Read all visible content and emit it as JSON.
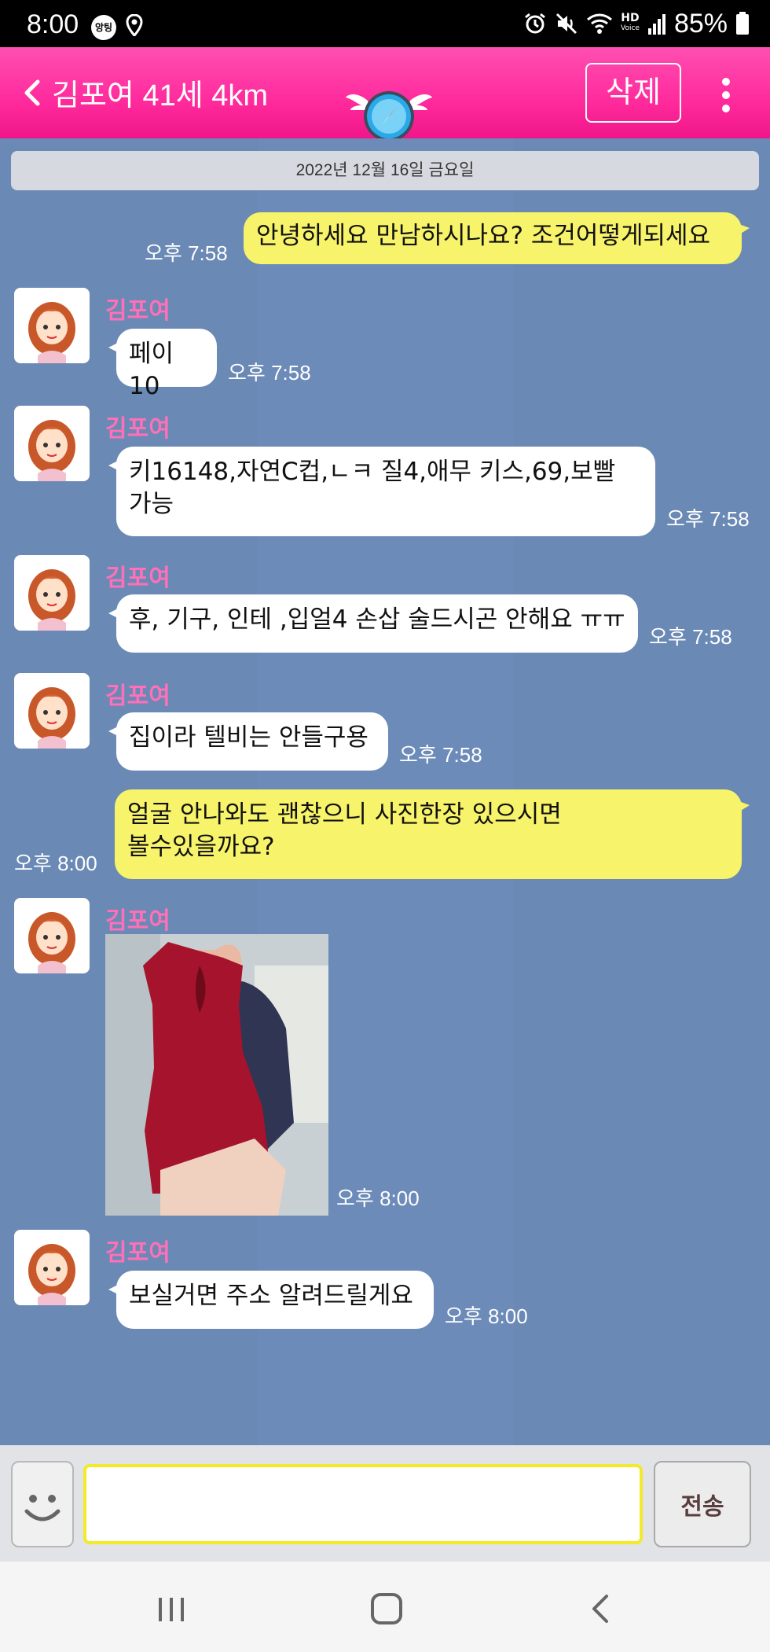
{
  "status_bar": {
    "time": "8:00",
    "app_badge": "앙팅",
    "battery_percent": "85%",
    "hd_label": "HD",
    "voice_label": "Voice"
  },
  "header": {
    "title": "김포여 41세 4km",
    "delete_label": "삭제"
  },
  "chat": {
    "date": "2022년 12월 16일 금요일",
    "sender_name": "김포여",
    "messages": [
      {
        "direction": "out",
        "text": "안녕하세요 만남하시나요? 조건어떻게되세요",
        "time": "오후 7:58"
      },
      {
        "direction": "in",
        "text": "페이10",
        "time": "오후 7:58"
      },
      {
        "direction": "in",
        "text": "키16148,자연C컵,ㄴㅋ 질4,애무 키스,69,보빨\n가능",
        "time": "오후 7:58"
      },
      {
        "direction": "in",
        "text": "후, 기구, 인테 ,입얼4 손삽 술드시곤 안해요 ㅠㅠ",
        "time": "오후 7:58"
      },
      {
        "direction": "in",
        "text": "집이라 텔비는 안들구용",
        "time": "오후 7:58"
      },
      {
        "direction": "out",
        "text": "얼굴 안나와도 괜찮으니 사진한장 있으시면\n볼수있을까요?",
        "time": "오후 8:00"
      },
      {
        "direction": "in",
        "type": "photo",
        "time": "오후 8:00"
      },
      {
        "direction": "in",
        "text": "보실거면 주소 알려드릴게요",
        "time": "오후 8:00"
      }
    ]
  },
  "input": {
    "value": "",
    "send_label": "전송"
  },
  "icons": {
    "back": "chevron-left-icon",
    "more": "more-vertical-icon",
    "emoji": "smiley-icon",
    "logo": "winged-compass-icon"
  },
  "colors": {
    "header_pink": "#ff2a9c",
    "chat_bg": "#6a89b5",
    "outgoing_bubble": "#f7f36a",
    "incoming_bubble": "#ffffff",
    "sender_name": "#ff70b8"
  }
}
